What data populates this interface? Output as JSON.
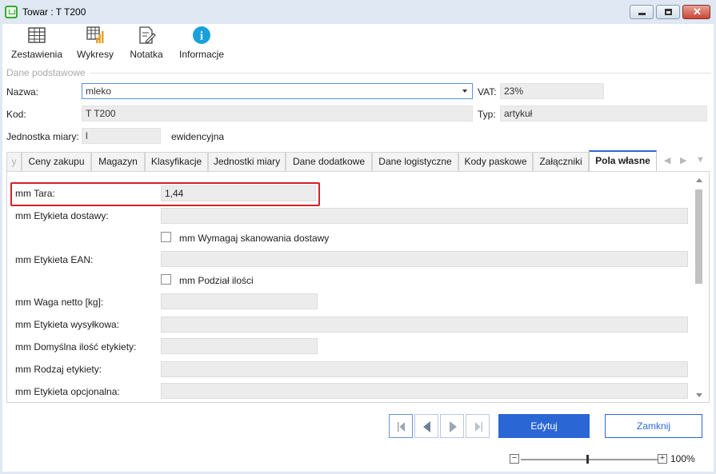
{
  "window": {
    "title": "Towar : T T200",
    "close_glyph": "✕"
  },
  "toolbar": {
    "items": [
      {
        "label": "Zestawienia",
        "icon": "table-icon"
      },
      {
        "label": "Wykresy",
        "icon": "chart-table-icon"
      },
      {
        "label": "Notatka",
        "icon": "note-icon"
      },
      {
        "label": "Informacje",
        "icon": "info-icon"
      }
    ],
    "info_glyph": "i"
  },
  "section": {
    "title": "Dane podstawowe"
  },
  "form": {
    "name_label": "Nazwa:",
    "name_value": "mleko",
    "vat_label": "VAT:",
    "vat_value": "23%",
    "code_label": "Kod:",
    "code_value": "T T200",
    "type_label": "Typ:",
    "type_value": "artykuł",
    "unit_label": "Jednostka miary:",
    "unit_value": "l",
    "unit_note": "ewidencyjna"
  },
  "tabs": [
    {
      "label": "y",
      "faded": true
    },
    {
      "label": "Ceny zakupu"
    },
    {
      "label": "Magazyn"
    },
    {
      "label": "Klasyfikacje"
    },
    {
      "label": "Jednostki miary"
    },
    {
      "label": "Dane dodatkowe"
    },
    {
      "label": "Dane logistyczne"
    },
    {
      "label": "Kody paskowe"
    },
    {
      "label": "Załączniki"
    },
    {
      "label": "Pola własne",
      "active": true
    }
  ],
  "tab_nav": {
    "prev": "◀",
    "next": "▶",
    "menu": "▼"
  },
  "custom_fields": {
    "tara_label": "mm Tara:",
    "tara_value": "1,44",
    "etykieta_dostawy_label": "mm Etykieta dostawy:",
    "etykieta_dostawy_value": "",
    "wymagaj_skan_label": "mm Wymagaj skanowania dostawy",
    "wymagaj_skan_checked": false,
    "etykieta_ean_label": "mm Etykieta EAN:",
    "etykieta_ean_value": "",
    "podzial_label": "mm Podział ilości",
    "podzial_checked": false,
    "waga_label": "mm Waga netto [kg]:",
    "waga_value": "",
    "etykieta_wysylkowa_label": "mm Etykieta wysyłkowa:",
    "etykieta_wysylkowa_value": "",
    "domyslna_ilosc_label": "mm Domyślna ilość etykiety:",
    "domyslna_ilosc_value": "",
    "rodzaj_label": "mm Rodzaj etykiety:",
    "rodzaj_value": "",
    "opcjonalna_label": "mm Etykieta opcjonalna:",
    "opcjonalna_value": ""
  },
  "footer": {
    "edit_label": "Edytuj",
    "close_label": "Zamknij",
    "zoom_minus": "−",
    "zoom_plus": "+",
    "zoom_value": "100%",
    "zoom_level": 0.5
  },
  "colors": {
    "accent": "#2b67d4",
    "highlight": "#d4212a",
    "info": "#1aa0d8"
  }
}
